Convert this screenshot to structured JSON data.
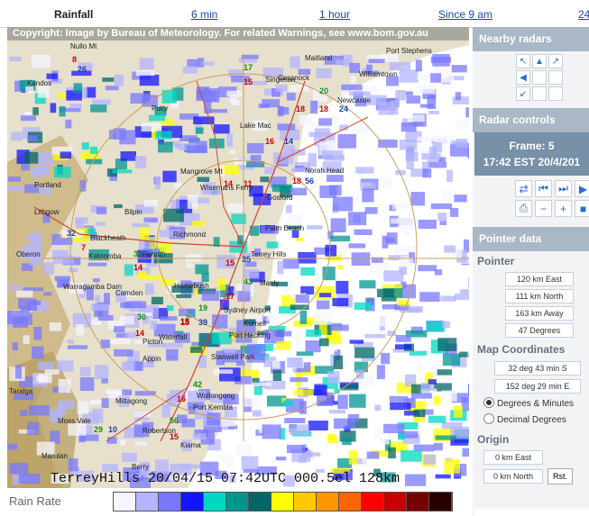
{
  "top_bar": {
    "title": "Rainfall",
    "links": [
      "6 min",
      "1 hour",
      "Since 9 am",
      "24"
    ]
  },
  "radar": {
    "copyright": "Copyright: Image by Bureau of Meteorology. For related Warnings, see www.bom.gov.au",
    "timestamp": "TerreyHills 20/04/15 07:42UTC 000.5el 128km",
    "places": [
      "Nullo Mt",
      "Kandos",
      "Putty",
      "Singleton",
      "Maitland",
      "Cessnock",
      "Port Stephens",
      "Williamtown",
      "Newcastle",
      "Lake Mac",
      "Norah Head",
      "Mangrove Mt",
      "Wisemans Ferry",
      "Gosford",
      "Bilpin",
      "Portland",
      "Lithgow",
      "Oberon",
      "Blackheath",
      "Katoomba",
      "Richmond",
      "Terrey Hills",
      "Warragamba Dam",
      "Homebush",
      "Sydney Airport",
      "Camden",
      "Picton",
      "Appin",
      "Kurnell",
      "Port Hacking",
      "Stanwell Park",
      "Mittagong",
      "Wollongong",
      "Port Kembla",
      "Moss Vale",
      "Robertson",
      "Kiama",
      "Taralga",
      "Marulan",
      "Berry",
      "Waterfall",
      "Penrith",
      "Palm Beach",
      "Manly"
    ],
    "observations": [
      {
        "temp": "8",
        "gust": "26"
      },
      {
        "temp": "17",
        "gust": "15"
      },
      {
        "temp": "20",
        "gust": "18"
      },
      {
        "temp": "18",
        "gust": "24"
      },
      {
        "temp": "16",
        "gust": "14"
      },
      {
        "temp": "14",
        "gust": "11"
      },
      {
        "temp": "18",
        "gust": "56"
      },
      {
        "temp": "32",
        "gust": "7"
      },
      {
        "temp": "30",
        "gust": "14"
      },
      {
        "temp": "15",
        "gust": "35"
      },
      {
        "temp": "17",
        "gust": "43"
      },
      {
        "temp": "15",
        "gust": "19"
      },
      {
        "temp": "30",
        "gust": "14"
      },
      {
        "temp": "15",
        "gust": "39"
      },
      {
        "temp": "16",
        "gust": "42"
      },
      {
        "temp": "29",
        "gust": "10"
      },
      {
        "temp": "56",
        "gust": "15"
      }
    ]
  },
  "legend": {
    "title": "Rain Rate",
    "colors": [
      "#f5f5ff",
      "#b4b4ff",
      "#7878ff",
      "#1414ff",
      "#00d8c3",
      "#009690",
      "#006666",
      "#ffff00",
      "#ffc800",
      "#ff9600",
      "#ff6400",
      "#ff0000",
      "#c80000",
      "#780000",
      "#280000"
    ]
  },
  "panel": {
    "nearby_title": "Nearby radars",
    "controls_title": "Radar controls",
    "frame_label": "Frame: 5",
    "frame_time": "17:42 EST 20/4/201",
    "pointer_title": "Pointer data",
    "pointer_sub": "Pointer",
    "east": "120 km East",
    "north": "111 km North",
    "away": "163 km Away",
    "degrees": "47 Degrees",
    "mapcoord_sub": "Map Coordinates",
    "lat": "32 deg 43 min S",
    "lon": "152 deg 29 min E",
    "radio_dm": "Degrees & Minutes",
    "radio_dd": "Decimal Degrees",
    "origin_sub": "Origin",
    "origin_east": "0 km East",
    "origin_north": "0 km North",
    "reset": "Rst."
  }
}
